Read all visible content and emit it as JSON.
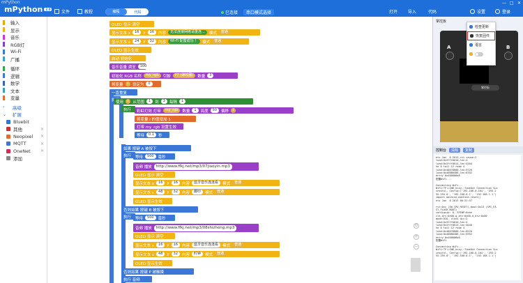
{
  "window": {
    "title": "mPython"
  },
  "header": {
    "brand": "mPython",
    "badge": "2.0",
    "file": "文件",
    "tutorial": "教程",
    "mode_block": "编程",
    "mode_code": "代码",
    "status": "已连接",
    "port": "串口模式选择",
    "open": "打开",
    "import": "导入",
    "code": "代码",
    "settings": "设置",
    "login": "登录"
  },
  "categories": [
    {
      "label": "输入",
      "color": "#e8a800"
    },
    {
      "label": "显示",
      "color": "#f2b315"
    },
    {
      "label": "音乐",
      "color": "#c43ad6"
    },
    {
      "label": "RGB灯",
      "color": "#7a42c8"
    },
    {
      "label": "Wi-Fi",
      "color": "#3a77d6"
    },
    {
      "label": "广播",
      "color": "#3aa0d6"
    },
    {
      "label": "循环",
      "color": "#2fa64b"
    },
    {
      "label": "逻辑",
      "color": "#3a77d6"
    },
    {
      "label": "数学",
      "color": "#3a63b8"
    },
    {
      "label": "文本",
      "color": "#3a9cb8"
    },
    {
      "label": "变量",
      "color": "#e36c2a"
    }
  ],
  "advanced": [
    {
      "label": "高级"
    },
    {
      "label": "扩展"
    }
  ],
  "extensions": [
    {
      "label": "Bluebit",
      "color": "#2b7bd6"
    },
    {
      "label": "其他",
      "color": "#d62b2b"
    },
    {
      "label": "Neopixel",
      "color": "#e36c2a"
    },
    {
      "label": "MQTT",
      "color": "#3a77d6"
    },
    {
      "label": "OneNet",
      "color": "#d62b5a"
    },
    {
      "label": "添加",
      "color": "#888888"
    }
  ],
  "blocks": {
    "b1": "OLED 显示 清空",
    "b2_a": "显示文本 x",
    "b2_x": "16",
    "b2_y": "16",
    "b2_c": "无法连接网络请重连...",
    "b2_m": "模式",
    "b2_mv": "普通",
    "b3_a": "显示文本 x",
    "b3_x": "24",
    "b3_y": "32",
    "b3_c": "Wi-Fi 配置成功 ！",
    "b3_m": "模式",
    "b3_mv": "普通",
    "b4": "OLED 显示生效",
    "b5": "启动 初始化",
    "b6_a": "音乐音量 调至",
    "b6_v": "100",
    "b7_a": "初始化 RGB 名称",
    "b7_n": "my_rgb",
    "b7_p": "引脚",
    "b7_pv": "P7 (蜂鸣器)",
    "b7_c": "数量",
    "b7_cv": "3",
    "b8_a": "将变量",
    "b8_v": "i",
    "b8_s": "设定为",
    "b8_val": "0",
    "b9": "一直重复",
    "b10": "执行",
    "b11_a": "使用",
    "b11_v": "i",
    "b11_f": "从范围",
    "b11_1": "1",
    "b11_t": "到",
    "b11_2": "3",
    "b11_s": "每隔",
    "b11_3": "1",
    "b12": "执行",
    "b13_a": "彩虹灯效 灯带",
    "b13_n": "my_rgb",
    "b13_c": "数量",
    "b13_cv": "1",
    "b13_h": "亮度",
    "b13_hv": "50",
    "b13_o": "偏移",
    "b13_ov": "i",
    "b14": "将变量 i 的值增加 1",
    "b15": "灯带 my_rgb 设置生效",
    "b16_a": "等待",
    "b16_v": "0.1",
    "b16_u": "秒",
    "b17": "如果 按键 A 被按下",
    "b18_a": "等待",
    "b18_v": "500",
    "b18_u": "毫秒",
    "b19_a": "音频 播放",
    "b19_url": "http://www.ffkj.net/mp3/07jiaoyin.mp3",
    "b20": "OLED 显示 清空",
    "b21_a": "显示文本 x",
    "b21_x": "16",
    "b21_y": "16",
    "b21_c": "蓝牙音乐连连看",
    "b21_m": "模式",
    "b21_mv": "普通",
    "b22_a": "显示文本 x",
    "b22_x": "48",
    "b22_y": "32",
    "b22_c": "脚印",
    "b22_m": "模式",
    "b22_mv": "普通",
    "b23": "OLED 显示生效",
    "b24": "否则如果 按键 B 被按下",
    "b25": "执行",
    "b26_a": "等待",
    "b26_v": "500",
    "b26_u": "毫秒",
    "b27_a": "音频 播放",
    "b27_url": "http://www.ffkj.net/mp3/08shizhong.mp3",
    "b28": "OLED 显示 清空",
    "b29_a": "显示文本 x",
    "b29_x": "16",
    "b29_y": "16",
    "b29_c": "蓝牙音乐连连看",
    "b29_m": "模式",
    "b29_mv": "普通",
    "b30_a": "显示文本 x",
    "b30_x": "48",
    "b30_y": "32",
    "b30_c": "时钟",
    "b30_m": "模式",
    "b30_mv": "普通",
    "b31": "OLED 显示生效",
    "b32": "否则如果 按键 P 被触摸",
    "b33": "执行 音频"
  },
  "menu": {
    "item1": "检查更新",
    "item2": "恢复固件",
    "item3": "语言",
    "item4": "主题"
  },
  "right_panel": {
    "tab1": "掌控板",
    "tab2": "",
    "board_label": "掌控板",
    "btn_a": "A",
    "btn_b": "B",
    "term_title": "控制台",
    "term_b1": "清除",
    "term_b2": "复制",
    "terminal_text": "ets Jan  8 2013,rst cause:2\nload:0x3fff0010,len:4\nload:0x3fff0014,len:4204\nho 0 tail 12 room 4\nload:0x40078000,len:9720\nload:0x40080400,len:6352\nentry 0x400806b8\n配置WiFi...\n\nConnecting WiFi...\nWiFi:TP-LINK_kcxy,:TimeOut Connection Suc\ncessful, Config:('192.168.0.104', '255.2\n55.255.0', '192.168.0.1', '192.168.1.1')\nimport machine,machine.reset()\nets Jan  8 2013 00:22:57\n\nrst:0xc (SW_CPU_RESET),boot:0x13 (SPI_FA\nST_FLASH_BOOT)\nconfigsip: 0, SPIWP:0xee\nclk_drv:0x00,q_drv:0x00,d_drv:0x00\nmode:DIO, clock div:2\nload:0x3fff0010,len:4\nload:0x3fff0014,len:4040\nho 0 tail 12 room 4\nload:0x40078000,len:8220\nload:0x40080400,len:5952\nentry 0x400806b8\n配置WiFi\n\nConnecting WiFi...\nWiFi:TP-LINK_kcxy,:TimeOut Connection Suc\ncessful, Config:('192.168.0.104', '255.2\n55.255.0', '192.168.0.1', '192.168.1.1')"
  }
}
